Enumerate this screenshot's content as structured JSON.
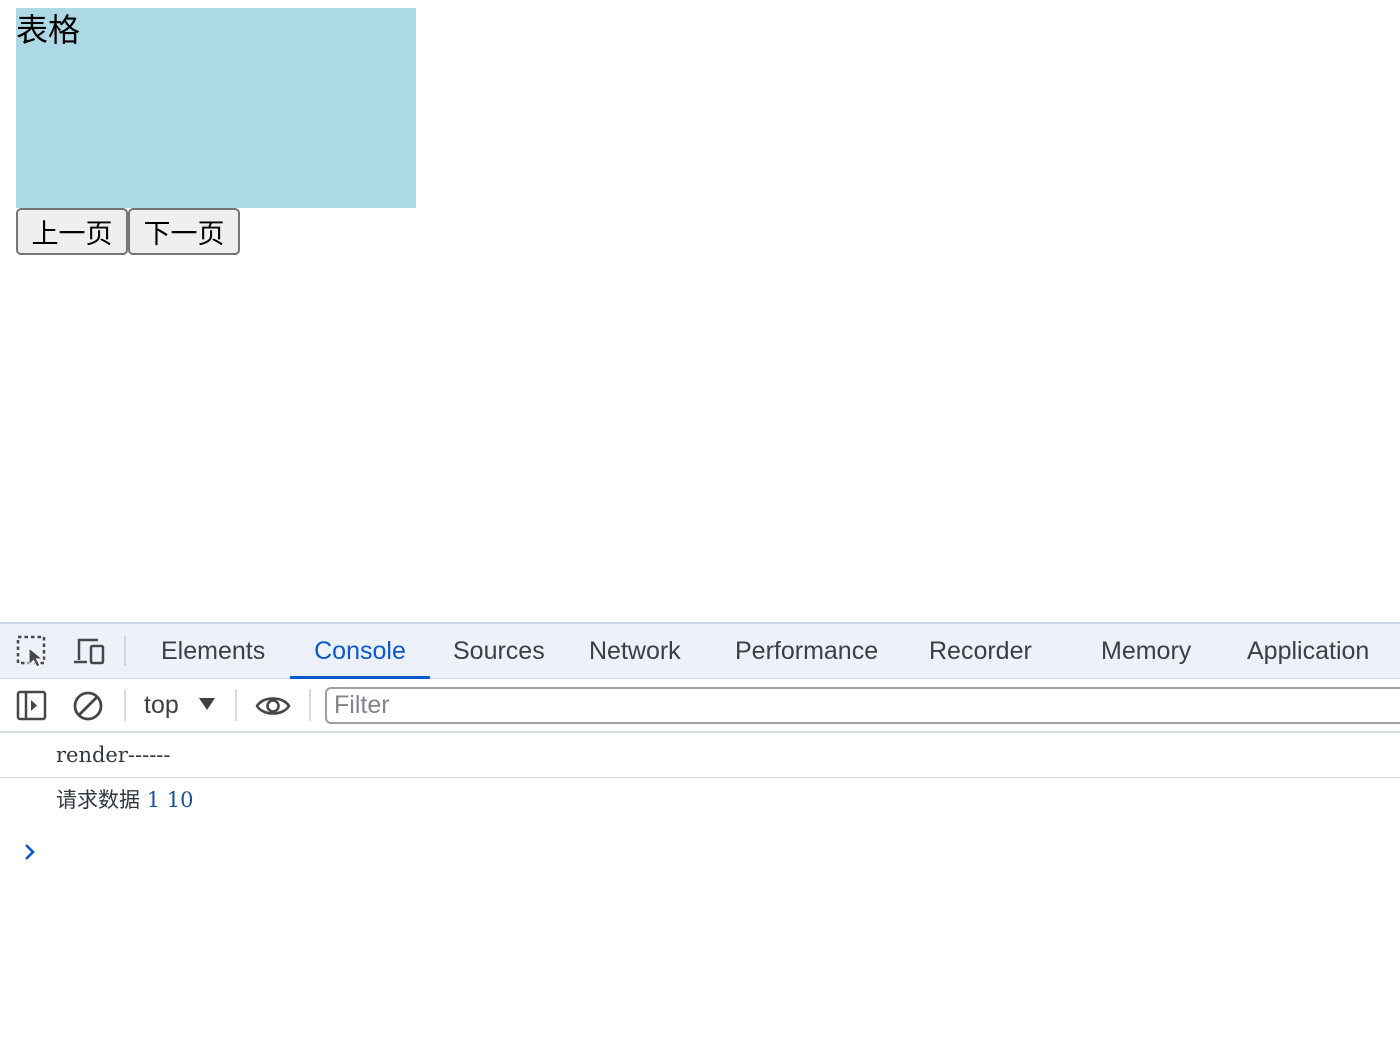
{
  "page": {
    "table_title": "表格",
    "prev_button": "上一页",
    "next_button": "下一页",
    "table_bg": "#add8e6"
  },
  "devtools": {
    "tabs": [
      {
        "label": "Elements"
      },
      {
        "label": "Console"
      },
      {
        "label": "Sources"
      },
      {
        "label": "Network"
      },
      {
        "label": "Performance"
      },
      {
        "label": "Recorder"
      },
      {
        "label": "Memory"
      },
      {
        "label": "Application"
      }
    ],
    "active_tab": "Console",
    "context": "top",
    "filter_placeholder": "Filter",
    "accent": "#0b57d0"
  },
  "console": {
    "log1": "render------",
    "log2_text": "请求数据",
    "log2_page": "1",
    "log2_size": "10"
  }
}
